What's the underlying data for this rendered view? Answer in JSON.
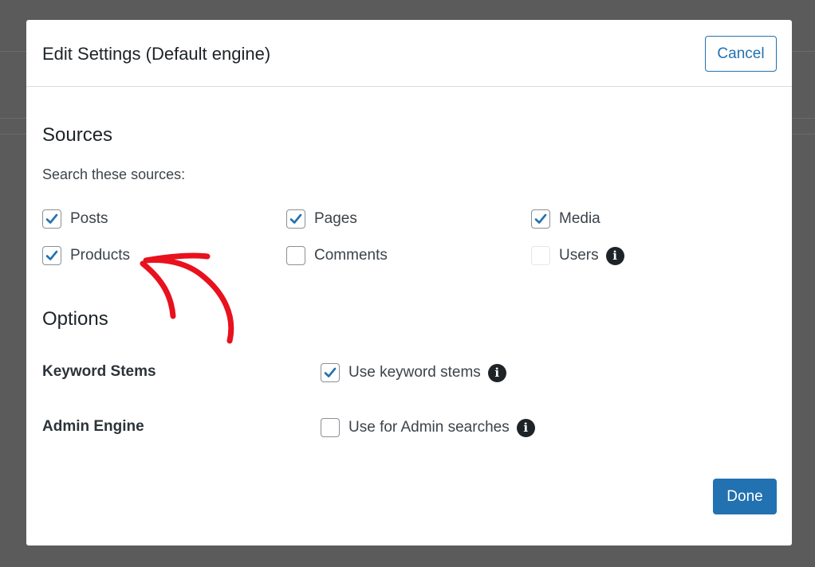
{
  "modal": {
    "title": "Edit Settings (Default engine)",
    "cancel_label": "Cancel",
    "done_label": "Done"
  },
  "sources": {
    "heading": "Sources",
    "subtitle": "Search these sources:",
    "items": [
      {
        "label": "Posts",
        "checked": true
      },
      {
        "label": "Pages",
        "checked": true
      },
      {
        "label": "Media",
        "checked": true
      },
      {
        "label": "Products",
        "checked": true
      },
      {
        "label": "Comments",
        "checked": false
      },
      {
        "label": "Users",
        "checked": false,
        "disabled": true,
        "info": true
      }
    ]
  },
  "options": {
    "heading": "Options",
    "rows": [
      {
        "label": "Keyword Stems",
        "checkbox_label": "Use keyword stems",
        "checked": true,
        "info": true
      },
      {
        "label": "Admin Engine",
        "checkbox_label": "Use for Admin searches",
        "checked": false,
        "info": true
      }
    ]
  },
  "icons": {
    "check": "check-icon",
    "info": "info-icon",
    "annotation": "red-arrow-annotation"
  },
  "colors": {
    "accent": "#2271b1",
    "annotation": "#e8111d"
  }
}
